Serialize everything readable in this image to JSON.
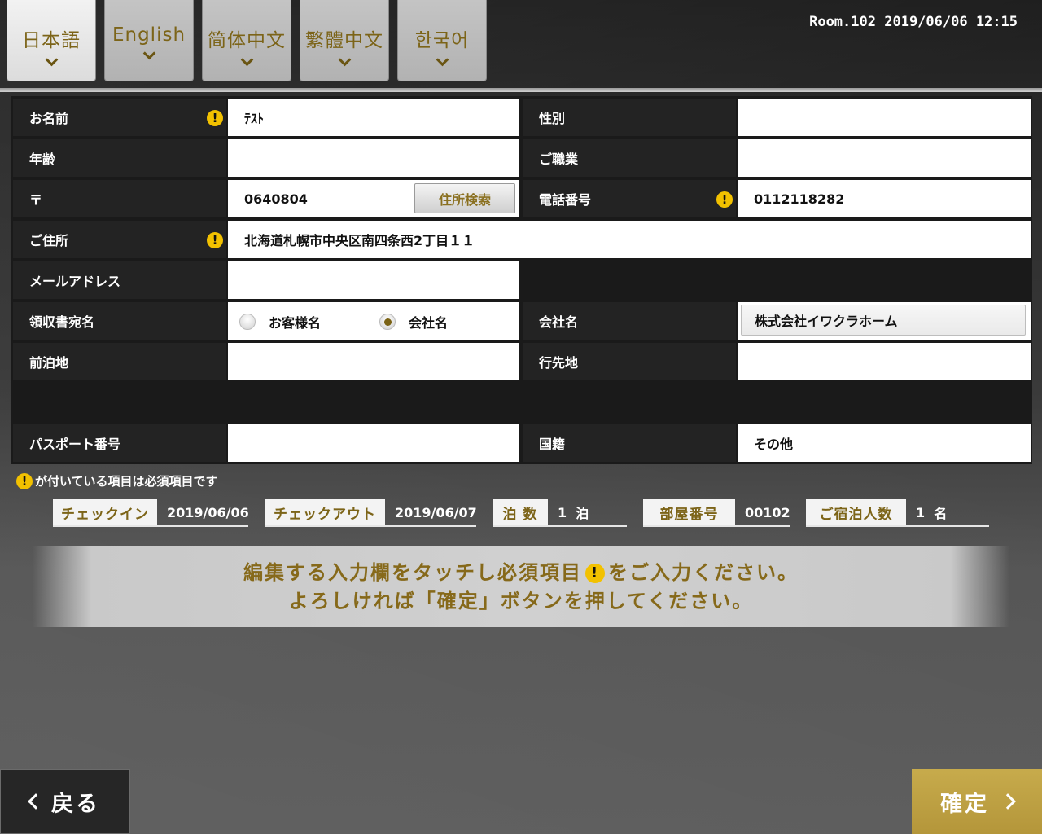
{
  "languages": [
    {
      "label": "日本語",
      "active": true
    },
    {
      "label": "English",
      "active": false
    },
    {
      "label": "简体中文",
      "active": false
    },
    {
      "label": "繁體中文",
      "active": false
    },
    {
      "label": "한국어",
      "active": false
    }
  ],
  "header": {
    "room": "Room.102",
    "datetime": "2019/06/06 12:15"
  },
  "form": {
    "name": {
      "label": "お名前",
      "value": "ﾃｽﾄ",
      "required": true
    },
    "gender": {
      "label": "性別",
      "value": ""
    },
    "age": {
      "label": "年齢",
      "value": ""
    },
    "occupation": {
      "label": "ご職業",
      "value": ""
    },
    "postal": {
      "label": "〒",
      "value": "0640804",
      "search_button": "住所検索"
    },
    "phone": {
      "label": "電話番号",
      "value": "0112118282",
      "required": true
    },
    "address": {
      "label": "ご住所",
      "value": "北海道札幌市中央区南四条西2丁目１１",
      "required": true
    },
    "email": {
      "label": "メールアドレス",
      "value": ""
    },
    "receipt": {
      "label": "領収書宛名",
      "options": [
        "お客様名",
        "会社名"
      ],
      "selected": "会社名"
    },
    "company": {
      "label": "会社名",
      "value": "株式会社イワクラホーム"
    },
    "previous_stay": {
      "label": "前泊地",
      "value": ""
    },
    "destination": {
      "label": "行先地",
      "value": ""
    },
    "passport": {
      "label": "パスポート番号",
      "value": ""
    },
    "nationality": {
      "label": "国籍",
      "value": "その他"
    }
  },
  "required_note": "が付いている項目は必須項目です",
  "required_icon": "!",
  "stay": {
    "checkin": {
      "label": "チェックイン",
      "value": "2019/06/06"
    },
    "checkout": {
      "label": "チェックアウト",
      "value": "2019/06/07"
    },
    "nights": {
      "label": "泊 数",
      "value": "1",
      "unit": "泊"
    },
    "room_no": {
      "label": "部屋番号",
      "value": "00102"
    },
    "guests": {
      "label": "ご宿泊人数",
      "value": "1",
      "unit": "名"
    }
  },
  "instructions": {
    "line1_a": "編集する入力欄をタッチし必須項目",
    "line1_b": "をご入力ください。",
    "line2": "よろしければ「確定」ボタンを押してください。"
  },
  "buttons": {
    "back": "戻る",
    "confirm": "確定"
  },
  "colors": {
    "accent_gold": "#b4963a",
    "required_yellow": "#f2c100",
    "label_text_gold": "#7c6418"
  }
}
